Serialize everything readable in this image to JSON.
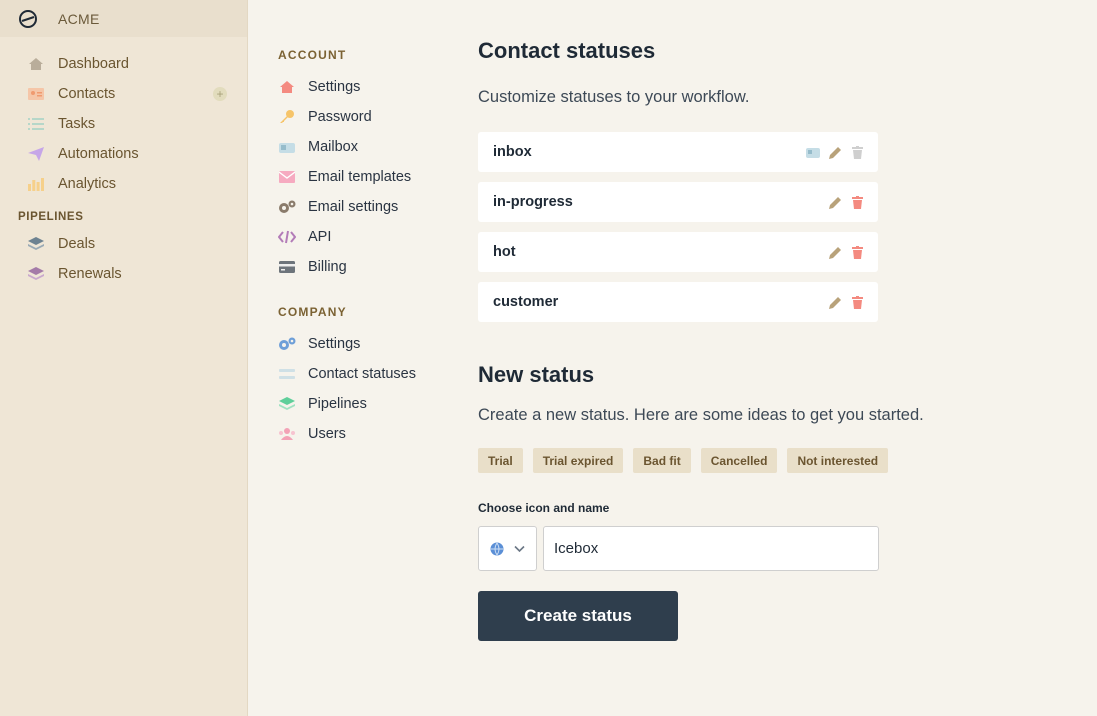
{
  "brand": {
    "name": "ACME"
  },
  "sidebar": {
    "items": [
      {
        "label": "Dashboard",
        "icon": "home-icon"
      },
      {
        "label": "Contacts",
        "icon": "contact-card-icon"
      },
      {
        "label": "Tasks",
        "icon": "list-icon"
      },
      {
        "label": "Automations",
        "icon": "paper-plane-icon"
      },
      {
        "label": "Analytics",
        "icon": "bar-chart-icon"
      }
    ],
    "pipelines_heading": "PIPELINES",
    "pipelines": [
      {
        "label": "Deals",
        "icon": "layers-icon"
      },
      {
        "label": "Renewals",
        "icon": "layers-icon"
      }
    ]
  },
  "settings_nav": {
    "account_heading": "ACCOUNT",
    "account": [
      {
        "label": "Settings",
        "icon": "home-icon"
      },
      {
        "label": "Password",
        "icon": "key-icon"
      },
      {
        "label": "Mailbox",
        "icon": "mailbox-icon"
      },
      {
        "label": "Email templates",
        "icon": "envelope-icon"
      },
      {
        "label": "Email settings",
        "icon": "gears-icon"
      },
      {
        "label": "API",
        "icon": "code-icon"
      },
      {
        "label": "Billing",
        "icon": "credit-card-icon"
      }
    ],
    "company_heading": "COMPANY",
    "company": [
      {
        "label": "Settings",
        "icon": "gears-icon"
      },
      {
        "label": "Contact statuses",
        "icon": "grip-lines-icon"
      },
      {
        "label": "Pipelines",
        "icon": "layers-icon"
      },
      {
        "label": "Users",
        "icon": "users-icon"
      }
    ]
  },
  "main": {
    "title": "Contact statuses",
    "subtitle": "Customize statuses to your workflow.",
    "statuses": [
      {
        "name": "inbox"
      },
      {
        "name": "in-progress"
      },
      {
        "name": "hot"
      },
      {
        "name": "customer"
      }
    ],
    "new_title": "New status",
    "new_subtitle": "Create a new status. Here are some ideas to get you started.",
    "ideas": [
      "Trial",
      "Trial expired",
      "Bad fit",
      "Cancelled",
      "Not interested"
    ],
    "field_label": "Choose icon and name",
    "name_value": "Icebox",
    "create_label": "Create status"
  },
  "colors": {
    "sidebar_bg": "#efe6d6",
    "page_bg": "#f6f3ec",
    "button_bg": "#2f3e4d",
    "chip_bg": "#e9dfc9",
    "delete_red": "#f48a80",
    "edit_tan": "#b8a27a"
  }
}
